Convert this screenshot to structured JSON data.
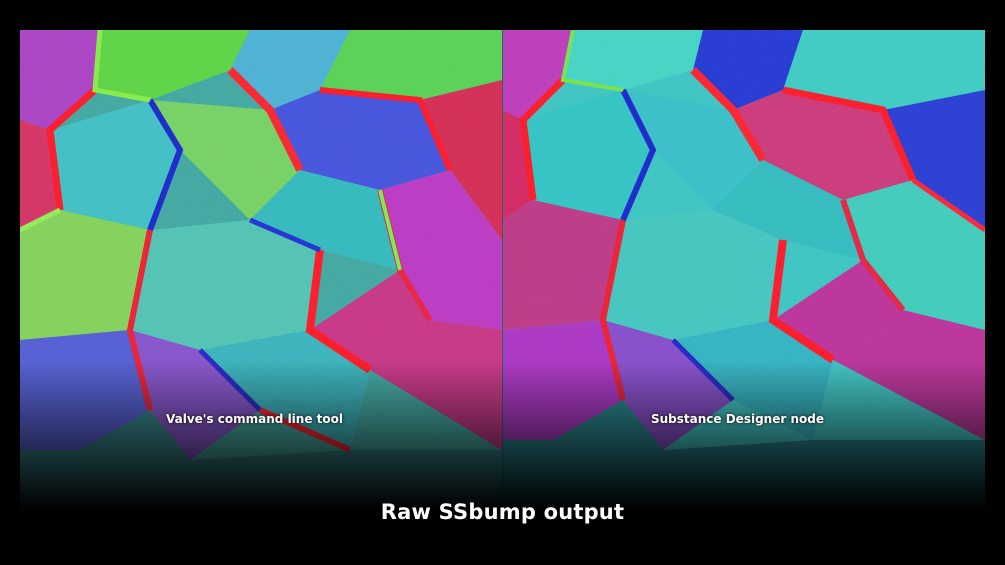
{
  "captions": {
    "left": "Valve's command line tool",
    "right": "Substance Designer node"
  },
  "title": "Raw SSbump output",
  "colors": {
    "background": "#000000",
    "text": "#ffffff",
    "red": "#e8203a",
    "green": "#5fe03c",
    "blue": "#2a3ce0",
    "cyan": "#3cc8c8",
    "magenta": "#c832c8"
  }
}
